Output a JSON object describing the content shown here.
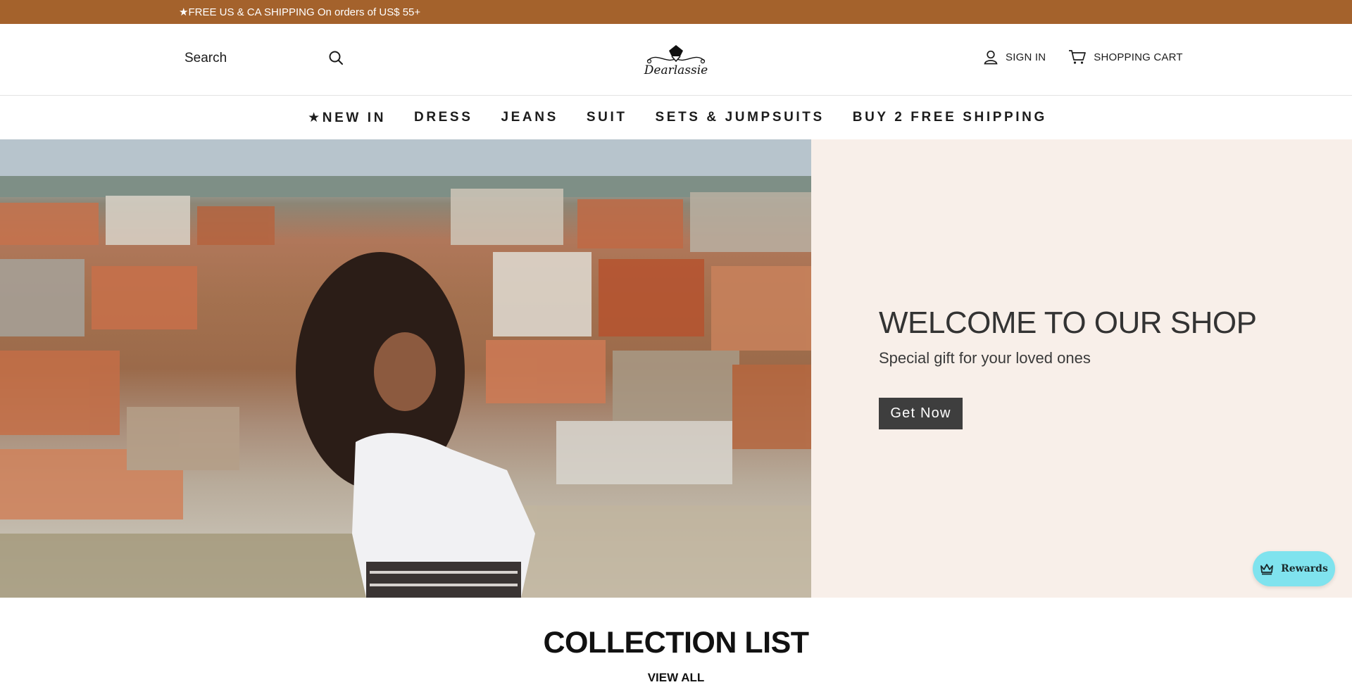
{
  "announcement": {
    "text": "★FREE US & CA SHIPPING On orders of US$ 55+"
  },
  "header": {
    "search": {
      "placeholder": "Search"
    },
    "logo_text": "Dearlassie",
    "sign_in_label": "SIGN IN",
    "cart_label": "SHOPPING CART"
  },
  "nav": {
    "items": [
      {
        "label": "★NEW IN"
      },
      {
        "label": "DRESS"
      },
      {
        "label": "JEANS"
      },
      {
        "label": "SUIT"
      },
      {
        "label": "SETS & JUMPSUITS"
      },
      {
        "label": "BUY 2 FREE SHIPPING"
      }
    ]
  },
  "hero": {
    "title": "WELCOME TO OUR SHOP",
    "subtitle": "Special gift for your loved ones",
    "cta_label": "Get Now"
  },
  "rewards": {
    "label": "Rewards"
  },
  "collection": {
    "title": "COLLECTION LIST",
    "view_all_label": "VIEW ALL"
  },
  "colors": {
    "announcement_bg": "#a4622c",
    "hero_panel_bg": "#f8efe9",
    "cta_bg": "#3e3e3e",
    "rewards_bg": "#7fe3ee"
  },
  "icons": {
    "search": "search-icon",
    "account": "user-icon",
    "cart": "cart-icon",
    "rewards": "crown-icon"
  }
}
